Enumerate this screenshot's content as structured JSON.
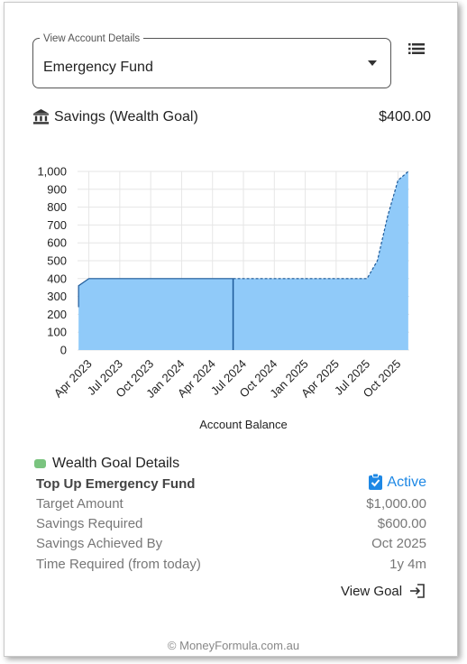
{
  "selector": {
    "legend": "View Account Details",
    "value": "Emergency Fund"
  },
  "header": {
    "icon": "bank-icon",
    "label": "Savings (Wealth Goal)",
    "amount": "$400.00"
  },
  "chart_data": {
    "type": "area",
    "xlabel": "Account Balance",
    "ylabel": "",
    "ylim": [
      0,
      1000
    ],
    "y_ticks": [
      "0",
      "100",
      "200",
      "300",
      "400",
      "500",
      "600",
      "700",
      "800",
      "900",
      "1,000"
    ],
    "x_ticks": [
      "Apr 2023",
      "Jul 2023",
      "Oct 2023",
      "Jan 2024",
      "Apr 2024",
      "Jul 2024",
      "Oct 2024",
      "Jan 2025",
      "Apr 2025",
      "Jul 2025",
      "Oct 2025"
    ],
    "grid": true,
    "fill_color": "#90caf9",
    "line_color": "#1e5a99",
    "series": [
      {
        "style": "solid",
        "points": [
          {
            "x": "Mar 2023",
            "y": 240
          },
          {
            "x": "Mar 2023",
            "y": 360
          },
          {
            "x": "Apr 2023",
            "y": 400
          },
          {
            "x": "Jun 2024",
            "y": 400
          }
        ]
      },
      {
        "style": "dashed",
        "points": [
          {
            "x": "Jun 2024",
            "y": 400
          },
          {
            "x": "Jul 2025",
            "y": 400
          },
          {
            "x": "Aug 2025",
            "y": 500
          },
          {
            "x": "Sep 2025",
            "y": 750
          },
          {
            "x": "Oct 2025",
            "y": 950
          },
          {
            "x": "Nov 2025",
            "y": 1000
          }
        ]
      }
    ],
    "marker_x": "Jun 2024"
  },
  "details": {
    "title": "Wealth Goal Details",
    "swatch_color": "#7ac47f",
    "goal_name": "Top Up Emergency Fund",
    "status": "Active",
    "rows": [
      {
        "label": "Target Amount",
        "value": "$1,000.00"
      },
      {
        "label": "Savings Required",
        "value": "$600.00"
      },
      {
        "label": "Savings Achieved By",
        "value": "Oct 2025"
      },
      {
        "label": "Time Required (from today)",
        "value": "1y 4m"
      }
    ],
    "view_goal": "View Goal"
  },
  "footer": "© MoneyFormula.com.au"
}
